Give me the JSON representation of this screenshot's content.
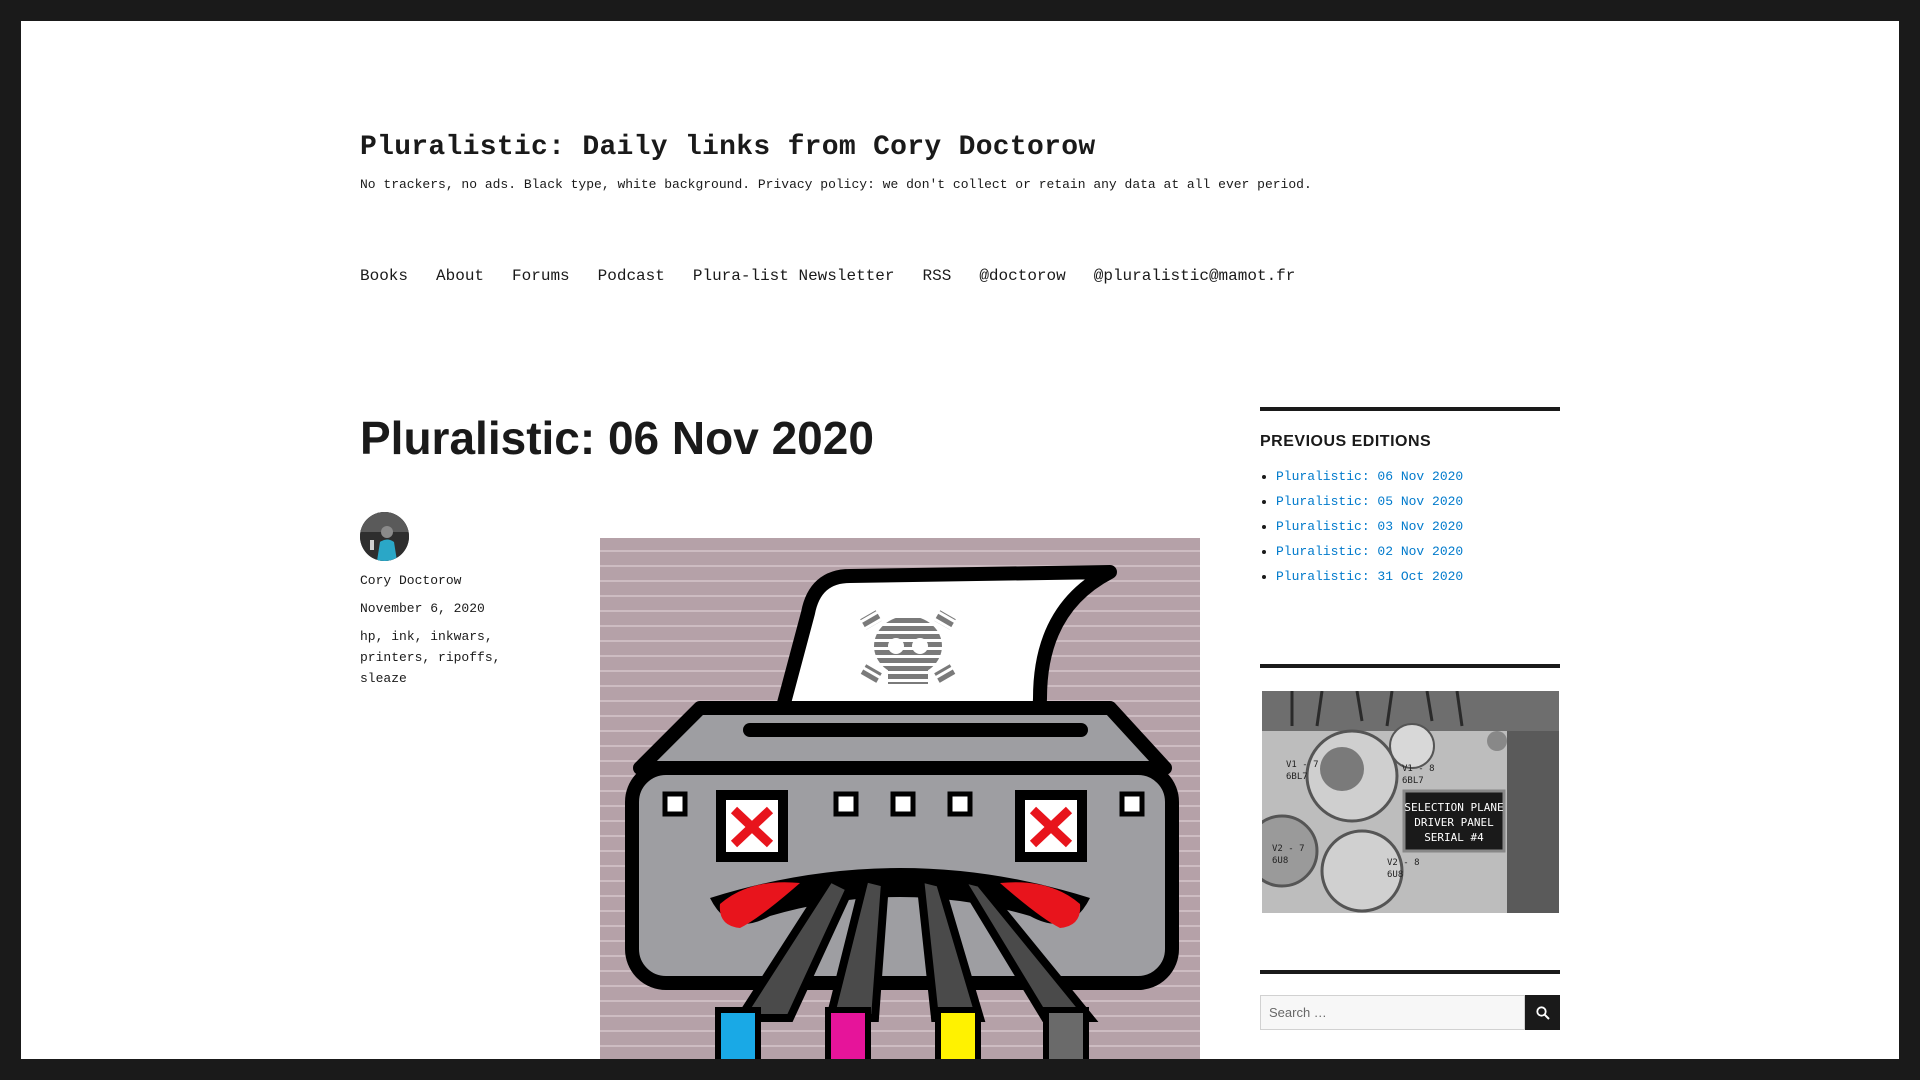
{
  "site": {
    "title": "Pluralistic: Daily links from Cory Doctorow",
    "description": "No trackers, no ads. Black type, white background. Privacy policy: we don't collect or retain any data at all ever period."
  },
  "nav": [
    {
      "label": "Books"
    },
    {
      "label": "About"
    },
    {
      "label": "Forums"
    },
    {
      "label": "Podcast"
    },
    {
      "label": "Plura-list Newsletter"
    },
    {
      "label": "RSS"
    },
    {
      "label": "@doctorow"
    },
    {
      "label": "@pluralistic@mamot.fr"
    }
  ],
  "post": {
    "title": "Pluralistic: 06 Nov 2020",
    "author": "Cory Doctorow",
    "date": "November 6, 2020",
    "tags": [
      "hp",
      "ink",
      "inkwars",
      "printers",
      "ripoffs",
      "sleaze"
    ]
  },
  "sidebar": {
    "previous_title": "PREVIOUS EDITIONS",
    "editions": [
      {
        "label": "Pluralistic: 06 Nov 2020"
      },
      {
        "label": "Pluralistic: 05 Nov 2020"
      },
      {
        "label": "Pluralistic: 03 Nov 2020"
      },
      {
        "label": "Pluralistic: 02 Nov 2020"
      },
      {
        "label": "Pluralistic: 31 Oct 2020"
      }
    ],
    "photo_label": [
      "SELECTION PLANE",
      "DRIVER PANEL",
      "SERIAL #4"
    ],
    "photo_tube_labels": [
      "V1 - 7",
      "6BL7",
      "V1 - 8",
      "6BL7",
      "V2 - 7",
      "6U8",
      "V2 - 8",
      "6U8"
    ]
  },
  "search": {
    "placeholder": "Search …",
    "button_icon": "search-icon"
  },
  "colors": {
    "link": "#007acc",
    "frame": "#1a1a1a",
    "text": "#1a1a1a"
  }
}
